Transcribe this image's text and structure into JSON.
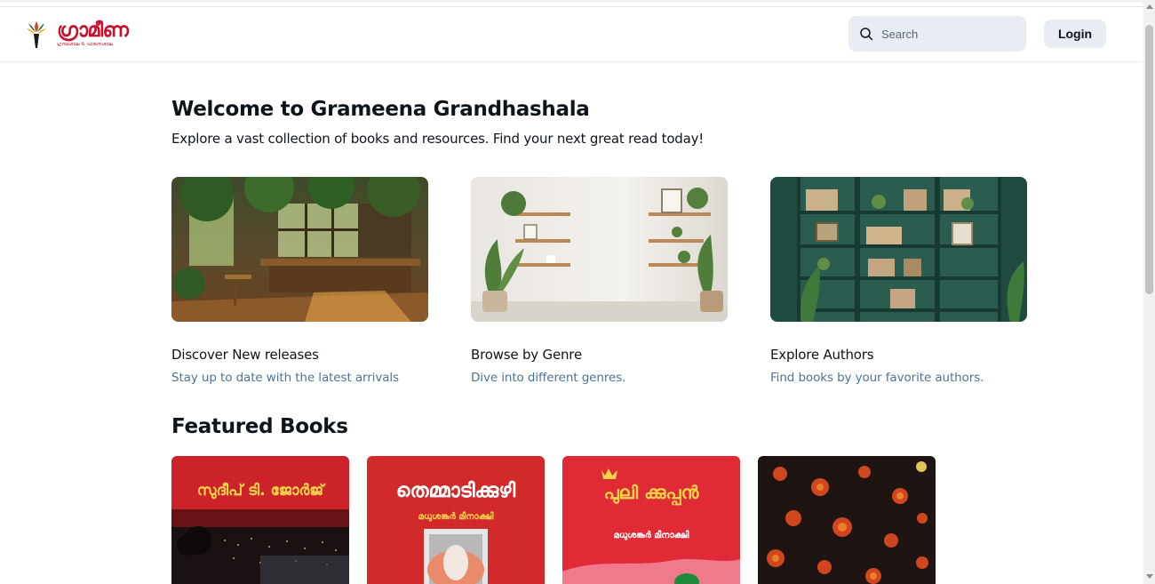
{
  "header": {
    "logo_text": "ഗ്രാമീണ",
    "logo_subtext": "ഗ്രന്ഥശാല & വായനശാല",
    "search_placeholder": "Search",
    "login_label": "Login"
  },
  "main": {
    "title": "Welcome to Grameena Grandhashala",
    "subtitle": "Explore a vast collection of books and resources. Find your next great read today!",
    "cards": [
      {
        "title": "Discover New releases",
        "description": "Stay up to date with the latest arrivals"
      },
      {
        "title": "Browse by Genre",
        "description": "Dive into different genres."
      },
      {
        "title": "Explore Authors",
        "description": "Find books by your favorite authors."
      }
    ],
    "featured_title": "Featured Books",
    "books": [
      {
        "cover_text": "സുദീപ് ടി. ജോർജ്"
      },
      {
        "cover_text": "തെമ്മാടിക്കുഴി",
        "cover_author": "മധുശങ്കർ മീനാക്ഷി"
      },
      {
        "cover_text": "പുലി ക്കുപ്പൻ",
        "cover_author": "മധുശങ്കർ മീനാക്ഷി"
      },
      {
        "cover_text": ""
      }
    ]
  },
  "colors": {
    "accent_bg": "#e7edf3",
    "link_text": "#4e7397",
    "brand_red": "#c8102e"
  }
}
